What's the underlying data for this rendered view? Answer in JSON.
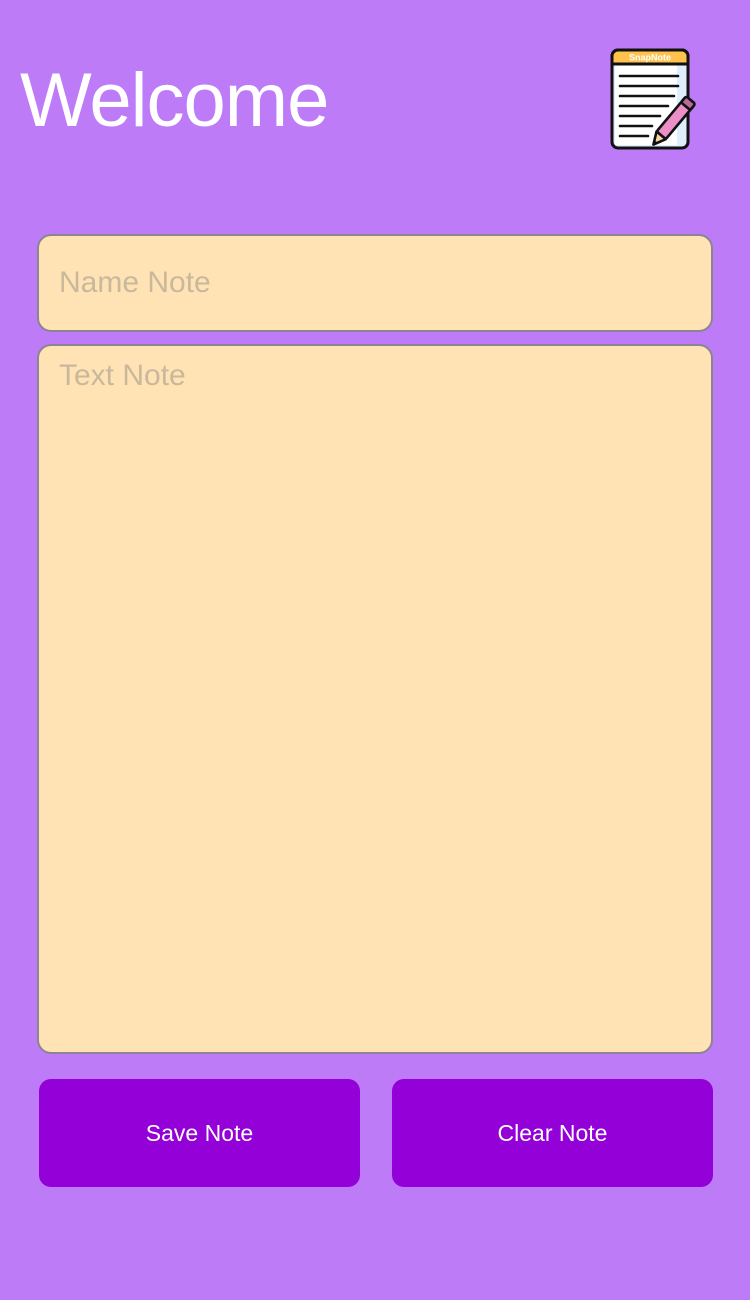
{
  "header": {
    "title": "Welcome",
    "logo": {
      "icon": "snapnote-notepad-pencil-icon",
      "label": "SnapNote"
    }
  },
  "form": {
    "name_placeholder": "Name Note",
    "name_value": "",
    "text_placeholder": "Text Note",
    "text_value": ""
  },
  "actions": {
    "save_label": "Save Note",
    "clear_label": "Clear Note"
  },
  "colors": {
    "background": "#bd7bf8",
    "field_background": "#ffe3b5",
    "button_background": "#9400d8",
    "title_text": "#ffffff"
  }
}
